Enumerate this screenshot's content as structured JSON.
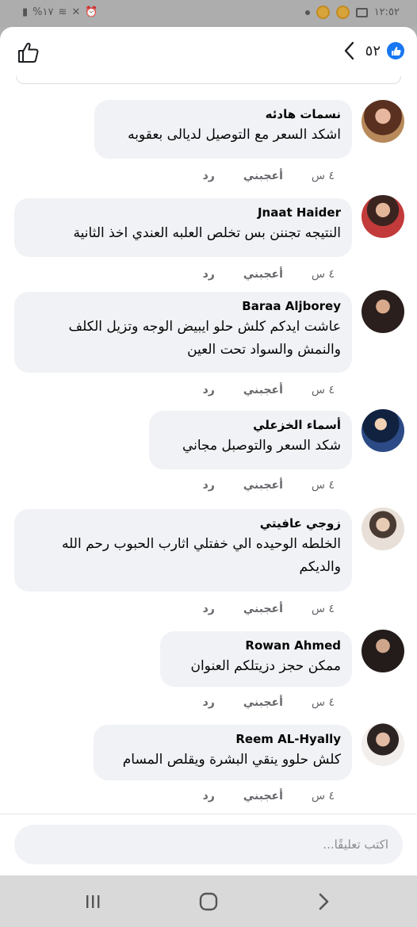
{
  "status_bar": {
    "battery": "%١٧",
    "time": "١٢:٥٢"
  },
  "header": {
    "reaction_count": "٥٢",
    "like_icon": "thumbs-up-outline-icon",
    "back_icon": "chevron-left-icon"
  },
  "comments": [
    {
      "name": "نسمات هادئه",
      "text": "اشكد السعر مع التوصيل لديالى بعقوبه",
      "time": "٤ س",
      "like": "أعجبني",
      "reply": "رد",
      "avatar_color": "#7a4a3a"
    },
    {
      "name": "Jnaat Haider",
      "text": "النتيجه تجننن بس تخلص العلبه العندي اخذ الثانية",
      "time": "٤ س",
      "like": "أعجبني",
      "reply": "رد",
      "avatar_color": "#c23a3a"
    },
    {
      "name": "Baraa Aljborey",
      "text_lines": [
        "عاشت ايدكم كلش حلو ايبيض الوجه وتزيل الكلف",
        "والنمش والسواد تحت العين"
      ],
      "time": "٤ س",
      "like": "أعجبني",
      "reply": "رد",
      "avatar_color": "#3a2f2c"
    },
    {
      "name": "أسماء الخزعلي",
      "text": "شكد السعر والتوصبل مجاني",
      "time": "٤ س",
      "like": "أعجبني",
      "reply": "رد",
      "avatar_color": "#1f3a6b"
    },
    {
      "name": "زوجي عافيتي",
      "text_lines": [
        "الخلطه الوحيده الي خفتلي اثارب الحبوب رحم الله",
        "والديكم"
      ],
      "time": "٤ س",
      "like": "أعجبني",
      "reply": "رد",
      "avatar_color": "#d8c7b8"
    },
    {
      "name": "Rowan Ahmed",
      "text": "ممكن حجز دزيتلكم العنوان",
      "time": "٤ س",
      "like": "أعجبني",
      "reply": "رد",
      "avatar_color": "#2b2420"
    },
    {
      "name": "Reem AL-Hyally",
      "text": "كلش حلوو ينقي البشرة ويقلص المسام",
      "time": "٤ س",
      "like": "أعجبني",
      "reply": "رد",
      "avatar_color": "#e8e2de"
    }
  ],
  "composer": {
    "placeholder": "اكتب تعليقًا..."
  },
  "nav": {
    "recents_icon": "recents-icon",
    "home_icon": "home-icon",
    "back_icon": "back-icon"
  }
}
